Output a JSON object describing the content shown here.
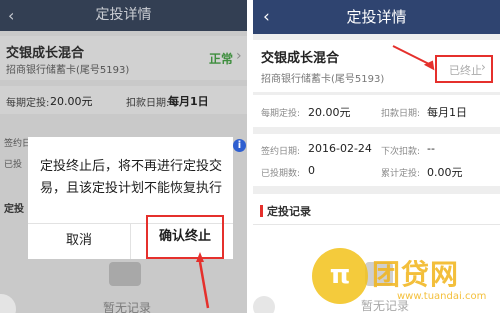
{
  "left": {
    "header_title": "定投详情",
    "back_icon": "‹",
    "fund_name": "交银成长混合",
    "bank": "招商银行储蓄卡(尾号5193)",
    "status": "正常",
    "status_arrow": "›",
    "per_period_label": "每期定投:",
    "per_period_value": "20.00元",
    "deduct_label": "扣款日期:",
    "deduct_value": "每月1日",
    "side_label_1": "签约日",
    "side_label_2": "已投",
    "side_label_3": "定投",
    "info_icon": "i",
    "empty_text": "暂无记录",
    "dialog": {
      "message": "定投终止后，将不再进行定投交易，且该定投计划不能恢复执行",
      "cancel": "取消",
      "confirm": "确认终止"
    }
  },
  "right": {
    "header_title": "定投详情",
    "back_icon": "‹",
    "fund_name": "交银成长混合",
    "bank": "招商银行储蓄卡(尾号5193)",
    "status": "已终止",
    "status_arrow": "›",
    "per_period_label": "每期定投:",
    "per_period_value": "20.00元",
    "deduct_label": "扣款日期:",
    "deduct_value": "每月1日",
    "sign_date_label": "签约日期:",
    "sign_date_value": "2016-02-24",
    "next_deduct_label": "下次扣款:",
    "next_deduct_value": "--",
    "invested_periods_label": "已投期数:",
    "invested_periods_value": "0",
    "total_label": "累计定投:",
    "total_value": "0.00元",
    "records_title": "定投记录",
    "empty_text": "暂无记录"
  },
  "watermark": {
    "coin_glyph": "π",
    "brand": "团贷网",
    "site": "www.tuandai.com"
  },
  "colors": {
    "highlight": "#e5302c",
    "header_right": "#2f4470",
    "status_normal": "#3e8e3e",
    "watermark": "#f2b51a"
  }
}
